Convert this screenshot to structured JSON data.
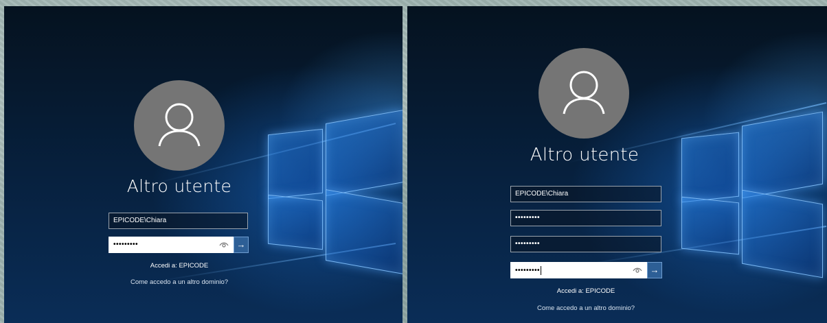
{
  "left_screen": {
    "user_title": "Altro utente",
    "username_value": "EPICODE\\Chiara",
    "password_value": "•••••••••",
    "sign_in_to": "Accedi a: EPICODE",
    "other_domain_link": "Come accedo a un altro dominio?"
  },
  "right_screen": {
    "user_title": "Altro utente",
    "username_value": "EPICODE\\Chiara",
    "current_password_value": "•••••••••",
    "new_password_value": "•••••••••",
    "confirm_password_value": "•••••••••",
    "sign_in_to": "Accedi a: EPICODE",
    "other_domain_link": "Come accedo a un altro dominio?"
  },
  "icons": {
    "avatar": "user-icon",
    "reveal": "eye-icon",
    "submit": "arrow-right-icon"
  },
  "colors": {
    "avatar_bg": "#757575",
    "submit_bg": "#2d5f96",
    "screen_bg": "#07213f"
  }
}
